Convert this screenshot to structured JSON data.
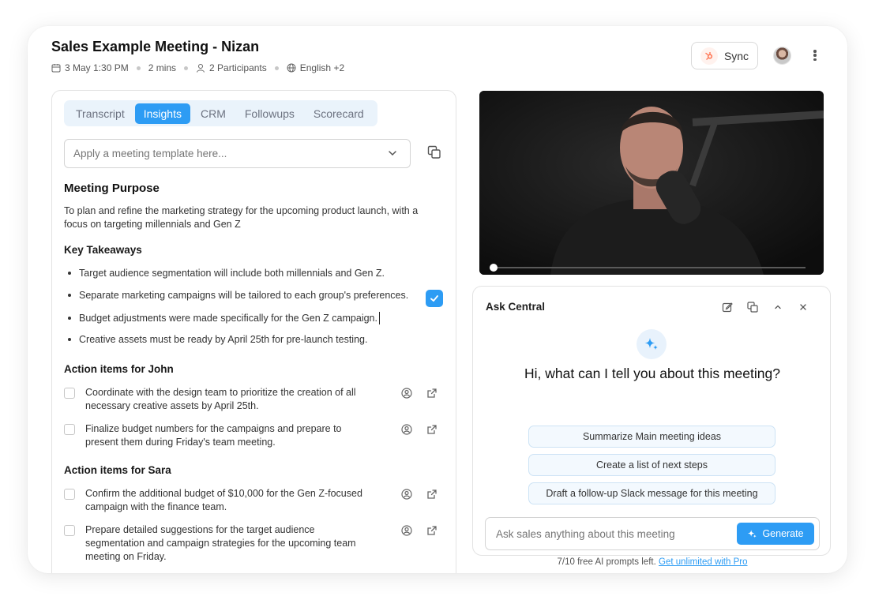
{
  "header": {
    "title": "Sales Example Meeting - Nizan",
    "date": "3 May 1:30 PM",
    "duration": "2 mins",
    "participants": "2 Participants",
    "language": "English +2",
    "sync_label": "Sync"
  },
  "tabs": [
    "Transcript",
    "Insights",
    "CRM",
    "Followups",
    "Scorecard"
  ],
  "active_tab": "Insights",
  "template": {
    "placeholder": "Apply a meeting template here..."
  },
  "meeting_purpose": {
    "heading": "Meeting Purpose",
    "text": "To plan and refine the marketing strategy for the upcoming product launch, with a focus on targeting millennials and Gen Z"
  },
  "key_takeaways": {
    "heading": "Key Takeaways",
    "items": [
      "Target audience segmentation will include both millennials and Gen Z.",
      "Separate marketing campaigns will be tailored to each group's preferences.",
      "Budget adjustments were made specifically for the Gen Z campaign.",
      "Creative assets must be ready by April 25th for pre-launch testing."
    ]
  },
  "action_items_john": {
    "heading": "Action items for John",
    "items": [
      "Coordinate with the design team to prioritize the creation of all necessary creative assets by April 25th.",
      "Finalize budget numbers for the campaigns and prepare to present them during Friday's team meeting."
    ]
  },
  "action_items_sara": {
    "heading": "Action items for Sara",
    "items": [
      "Confirm the additional budget of $10,000 for the Gen Z-focused campaign with the finance team.",
      "Prepare detailed suggestions for the target audience segmentation and campaign strategies for the upcoming team meeting on Friday."
    ]
  },
  "video": {
    "progress": 0.0
  },
  "ask": {
    "title": "Ask Central",
    "greeting": "Hi, what can I tell you about this meeting?",
    "suggestions": [
      "Summarize Main meeting ideas",
      "Create a list of next steps",
      "Draft a follow-up Slack message for this meeting"
    ],
    "input_placeholder": "Ask sales anything about this meeting",
    "generate_label": "Generate",
    "quota_text": "7/10 free AI prompts left.",
    "upgrade_link": "Get unlimited with Pro"
  },
  "colors": {
    "accent": "#2d9cf4",
    "tab_bg": "#eaf3fb",
    "hubspot": "#ff7a59"
  }
}
